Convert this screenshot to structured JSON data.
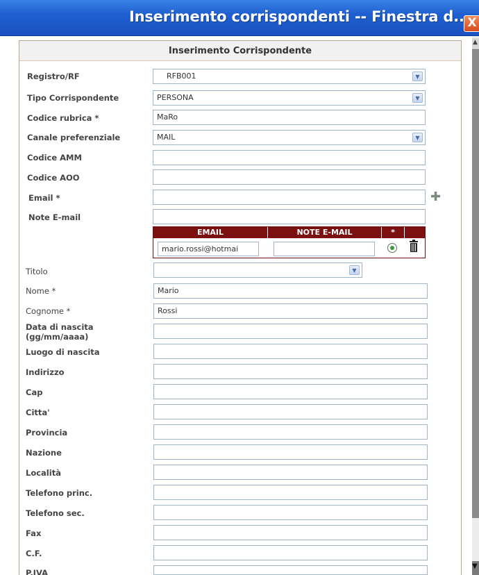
{
  "window": {
    "title": "Inserimento corrispondenti -- Finestra d...",
    "close_glyph": "X"
  },
  "panel": {
    "header": "Inserimento Corrispondente"
  },
  "form": {
    "registro_label": "Registro/RF",
    "registro_value": "RFB001",
    "tipo_label": "Tipo Corrispondente",
    "tipo_value": "PERSONA",
    "codice_rubrica_label": "Codice rubrica *",
    "codice_rubrica_value": "MaRo",
    "canale_label": "Canale preferenziale",
    "canale_value": "MAIL",
    "codice_amm_label": "Codice AMM",
    "codice_aoo_label": "Codice AOO",
    "email_label": "Email *",
    "note_email_label": "Note E-mail",
    "titolo_label": "Titolo",
    "nome_label": "Nome *",
    "nome_value": "Mario",
    "cognome_label": "Cognome *",
    "cognome_value": "Rossi",
    "data_nascita_label_line1": "Data di nascita",
    "data_nascita_label_line2": "(gg/mm/aaaa)",
    "luogo_nascita_label": "Luogo di nascita",
    "indirizzo_label": "Indirizzo",
    "cap_label": "Cap",
    "citta_label": "Citta'",
    "provincia_label": "Provincia",
    "nazione_label": "Nazione",
    "localita_label": "Località",
    "tel_princ_label": "Telefono princ.",
    "tel_sec_label": "Telefono sec.",
    "fax_label": "Fax",
    "cf_label": "C.F.",
    "piva_label": "P.IVA"
  },
  "email_table": {
    "col_email": "EMAIL",
    "col_note": "NOTE E-MAIL",
    "col_pref": "*",
    "row_email": "mario.rossi@hotmai",
    "row_note": ""
  },
  "icons": {
    "plus": "add-email-icon",
    "radio": "preferred-radio-icon",
    "trash": "trash-icon",
    "dropdown": "chevron-down-icon"
  }
}
